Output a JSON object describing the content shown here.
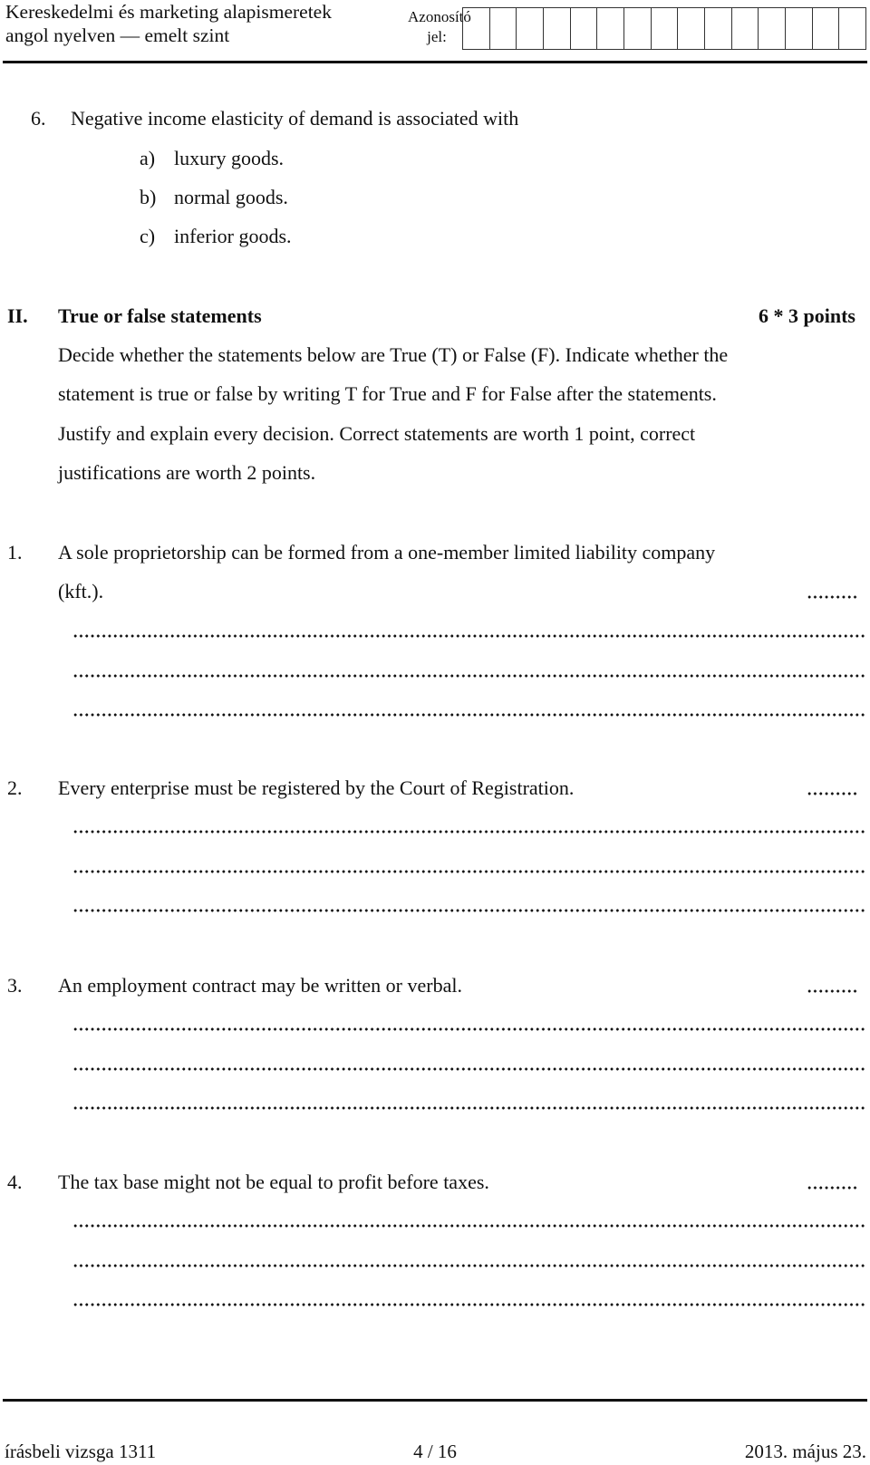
{
  "header": {
    "title_line1": "Kereskedelmi és marketing alapismeretek",
    "title_line2": "angol nyelven — emelt szint",
    "id_label_line1": "Azonosító",
    "id_label_line2": "jel:",
    "id_box_count": 15
  },
  "question6": {
    "number": "6.",
    "text": "Negative income elasticity of demand is associated with",
    "options": [
      {
        "label": "a)",
        "text": "luxury goods."
      },
      {
        "label": "b)",
        "text": "normal goods."
      },
      {
        "label": "c)",
        "text": "inferior goods."
      }
    ]
  },
  "section2": {
    "numeral": "II.",
    "title": "True or false statements",
    "points": "6 * 3 points",
    "instructions": [
      "Decide whether the statements below are True (T) or False (F). Indicate whether the",
      "statement is true or false by writing T for True and F for False after the statements.",
      "Justify and explain every decision. Correct statements are worth 1 point, correct",
      "justifications are worth 2 points."
    ],
    "statements": [
      {
        "number": "1.",
        "line1": "A sole proprietorship can be formed from a one-member limited liability company",
        "line2": "(kft.)."
      },
      {
        "number": "2.",
        "line1": "Every enterprise must be registered by the Court of Registration."
      },
      {
        "number": "3.",
        "line1": "An employment contract may be written or verbal."
      },
      {
        "number": "4.",
        "line1": "The tax base might not be equal to profit before taxes."
      }
    ]
  },
  "footer": {
    "left": "írásbeli vizsga 1311",
    "center": "4 / 16",
    "right": "2013. május 23."
  }
}
